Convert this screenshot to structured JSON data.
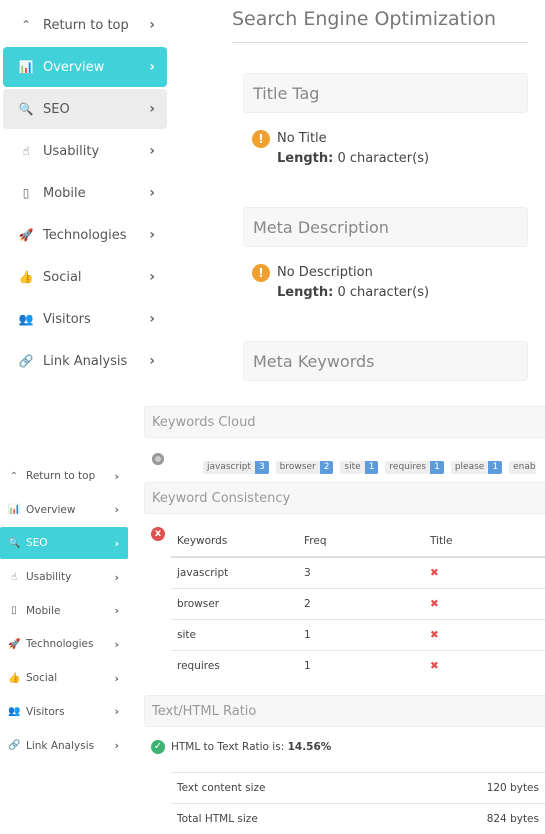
{
  "nav": [
    {
      "label": "Return to top",
      "icon": "chevron-up-icon",
      "glyph": "⌃"
    },
    {
      "label": "Overview",
      "icon": "bar-chart-icon",
      "glyph": "📊"
    },
    {
      "label": "SEO",
      "icon": "search-icon",
      "glyph": "🔍"
    },
    {
      "label": "Usability",
      "icon": "pointer-hand-icon",
      "glyph": "☝"
    },
    {
      "label": "Mobile",
      "icon": "mobile-icon",
      "glyph": "▯"
    },
    {
      "label": "Technologies",
      "icon": "rocket-icon",
      "glyph": "🚀"
    },
    {
      "label": "Social",
      "icon": "thumbs-up-icon",
      "glyph": "👍"
    },
    {
      "label": "Visitors",
      "icon": "users-icon",
      "glyph": "👥"
    },
    {
      "label": "Link Analysis",
      "icon": "link-icon",
      "glyph": "🔗"
    }
  ],
  "title": "Search Engine Optimization",
  "title_tag": {
    "heading": "Title Tag",
    "value": "No Title",
    "length_label": "Length:",
    "length": "0 character(s)"
  },
  "meta_desc": {
    "heading": "Meta Description",
    "value": "No Description",
    "length_label": "Length:",
    "length": "0 character(s)"
  },
  "meta_keywords": {
    "heading": "Meta Keywords"
  },
  "cloud": {
    "heading": "Keywords Cloud",
    "tags": [
      {
        "word": "javascript",
        "count": "3"
      },
      {
        "word": "browser",
        "count": "2"
      },
      {
        "word": "site",
        "count": "1"
      },
      {
        "word": "requires",
        "count": "1"
      },
      {
        "word": "please",
        "count": "1"
      },
      {
        "word": "enab",
        "count": ""
      }
    ]
  },
  "consistency": {
    "heading": "Keyword Consistency",
    "columns": [
      "Keywords",
      "Freq",
      "Title"
    ],
    "rows": [
      [
        "javascript",
        "3",
        "✖"
      ],
      [
        "browser",
        "2",
        "✖"
      ],
      [
        "site",
        "1",
        "✖"
      ],
      [
        "requires",
        "1",
        "✖"
      ]
    ]
  },
  "ratio": {
    "heading": "Text/HTML Ratio",
    "label": "HTML to Text Ratio is:",
    "value": "14.56%",
    "rows": [
      [
        "Text content size",
        "120 bytes"
      ],
      [
        "Total HTML size",
        "824 bytes"
      ]
    ]
  },
  "colors": {
    "accent": "#41d1d9",
    "warning": "#f0a030",
    "error": "#e05050",
    "success": "#3cb371",
    "tag_count": "#5d9cdb"
  }
}
